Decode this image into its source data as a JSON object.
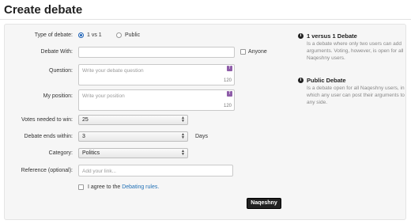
{
  "page": {
    "title": "Create debate"
  },
  "form": {
    "type_label": "Type of debate:",
    "type_options": [
      "1 vs 1",
      "Public"
    ],
    "debate_with_label": "Debate With:",
    "anyone_label": "Anyone",
    "question_label": "Question:",
    "question_placeholder": "Write your debate question",
    "question_counter": "120",
    "position_label": "My position:",
    "position_placeholder": "Write your position",
    "position_counter": "120",
    "votes_label": "Votes needed to win:",
    "votes_value": "25",
    "ends_label": "Debate ends within:",
    "ends_value": "3",
    "ends_unit": "Days",
    "category_label": "Category:",
    "category_value": "Politics",
    "reference_label": "Reference (optional):",
    "reference_placeholder": "Add your link...",
    "agree_text": "I agree to the",
    "agree_link": "Debating rules.",
    "submit_label": "Naqeshny"
  },
  "info": [
    {
      "title": "1 versus 1 Debate",
      "desc": "Is a debate where only two users can add arguments. Voting, however, is open for all Naqeshny users."
    },
    {
      "title": "Public Debate",
      "desc": "Is a debate open for all Naqeshny users, in which any user can post their arguments to any side."
    }
  ],
  "colors": {
    "accent": "#1a5fb4",
    "link": "#1f6fb5",
    "button": "#222222",
    "icon_purple": "#8e5ca8"
  }
}
